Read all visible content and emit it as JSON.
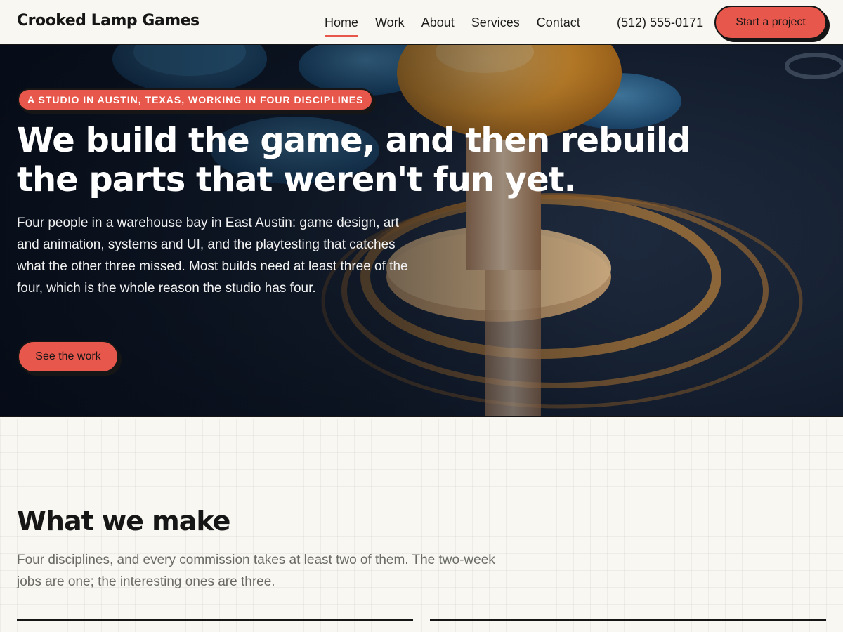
{
  "header": {
    "logo": "Crooked Lamp Games",
    "nav": [
      {
        "label": "Home",
        "active": true
      },
      {
        "label": "Work",
        "active": false
      },
      {
        "label": "About",
        "active": false
      },
      {
        "label": "Services",
        "active": false
      },
      {
        "label": "Contact",
        "active": false
      }
    ],
    "phone": "(512) 555-0171",
    "cta_label": "Start a project"
  },
  "hero": {
    "tagline": "A STUDIO IN AUSTIN, TEXAS, WORKING IN FOUR DISCIPLINES",
    "title": "We build the game, and then rebuild the parts that weren't fun yet.",
    "body": "Four people in a warehouse bay in East Austin: game design, art and animation, systems and UI, and the playtesting that catches what the other three missed. Most builds need at least three of the four, which is the whole reason the studio has four.",
    "button_label": "See the work",
    "background_image": "arcade-joystick-photo"
  },
  "section": {
    "title": "What we make",
    "body": "Four disciplines, and every commission takes at least two of them. The two-week jobs are one; the interesting ones are three."
  },
  "colors": {
    "accent": "#e8574c",
    "ink": "#161616",
    "paper": "#f8f7f1"
  }
}
